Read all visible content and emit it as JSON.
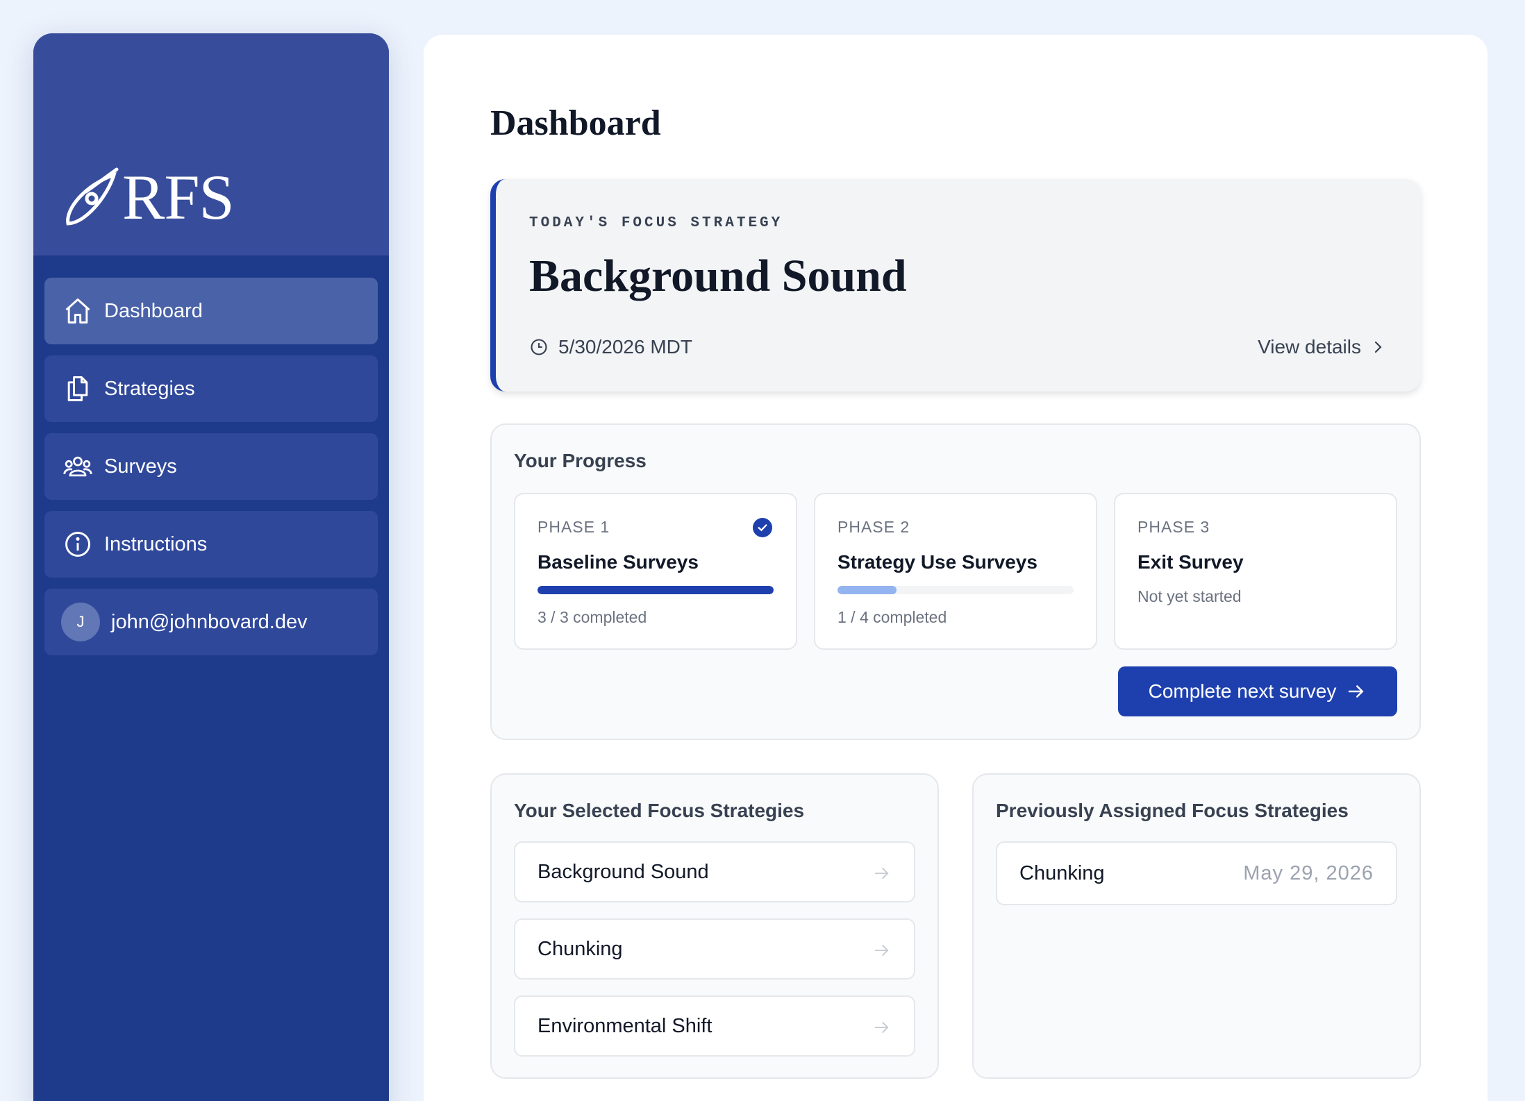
{
  "app": {
    "logo_text": "RFS"
  },
  "sidebar": {
    "items": [
      {
        "label": "Dashboard",
        "icon": "home-icon",
        "active": true
      },
      {
        "label": "Strategies",
        "icon": "documents-icon"
      },
      {
        "label": "Surveys",
        "icon": "users-icon"
      },
      {
        "label": "Instructions",
        "icon": "info-icon"
      }
    ],
    "user": {
      "initial": "J",
      "email": "john@johnbovard.dev"
    }
  },
  "page": {
    "title": "Dashboard"
  },
  "focus": {
    "eyebrow": "TODAY'S FOCUS STRATEGY",
    "name": "Background Sound",
    "date": "5/30/2026 MDT",
    "view_details": "View details"
  },
  "progress": {
    "title": "Your Progress",
    "phases": [
      {
        "label": "PHASE 1",
        "title": "Baseline Surveys",
        "status": "3 / 3 completed",
        "done": true,
        "fraction": 1.0
      },
      {
        "label": "PHASE 2",
        "title": "Strategy Use Surveys",
        "status": "1 / 4 completed",
        "done": false,
        "fraction": 0.25
      },
      {
        "label": "PHASE 3",
        "title": "Exit Survey",
        "note": "Not yet started"
      }
    ],
    "next_button": "Complete next survey"
  },
  "selected": {
    "title": "Your Selected Focus Strategies",
    "items": [
      "Background Sound",
      "Chunking",
      "Environmental Shift"
    ]
  },
  "previous": {
    "title": "Previously Assigned Focus Strategies",
    "items": [
      {
        "name": "Chunking",
        "date": "May 29, 2026"
      }
    ]
  },
  "colors": {
    "primary": "#1e40af",
    "sidebar": "#1e3a8a",
    "progress_partial": "#93b4f0"
  }
}
